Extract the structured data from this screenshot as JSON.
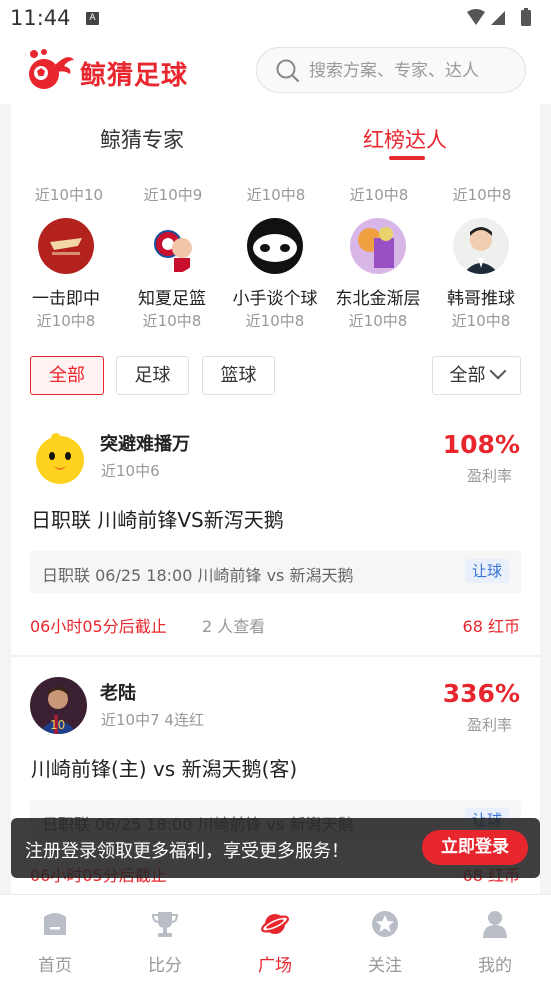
{
  "status_bar": {
    "time": "11:44",
    "notif_icon": "A"
  },
  "header": {
    "app_name": "鲸猜足球",
    "search_placeholder": "搜索方案、专家、达人"
  },
  "tabs": [
    "鲸猜专家",
    "红榜达人"
  ],
  "active_tab": 1,
  "experts_row1_records": [
    "近10中10",
    "近10中9",
    "近10中8",
    "近10中8",
    "近10中8"
  ],
  "experts_row2": [
    {
      "name": "一击即中",
      "record": "近10中8"
    },
    {
      "name": "知夏足篮",
      "record": "近10中8"
    },
    {
      "name": "小手谈个球",
      "record": "近10中8"
    },
    {
      "name": "东北金渐层",
      "record": "近10中8"
    },
    {
      "name": "韩哥推球",
      "record": "近10中8"
    }
  ],
  "filters": {
    "all": "全部",
    "football": "足球",
    "basketball": "篮球",
    "dropdown": "全部"
  },
  "posts": [
    {
      "author": "突避难播万",
      "record": "近10中6",
      "rate": "108%",
      "rate_label": "盈利率",
      "title": "日职联  川崎前锋VS新泻天鹅",
      "match": "日职联 06/25 18:00 川崎前锋 vs 新潟天鹅",
      "tag": "让球",
      "deadline": "06小时05分后截止",
      "views": "2 人查看",
      "price": "68 红币"
    },
    {
      "author": "老陆",
      "record": "近10中7   4连红",
      "rate": "336%",
      "rate_label": "盈利率",
      "title": "川崎前锋(主) vs 新潟天鹅(客)",
      "match": "日职联 06/25 18:00 川崎前锋 vs 新潟天鹅",
      "tag": "让球",
      "deadline": "06小时05分后截止",
      "views": "",
      "price": "68 红币"
    }
  ],
  "banner": {
    "text": "注册登录领取更多福利，享受更多服务！",
    "button": "立即登录"
  },
  "bottom_nav": [
    {
      "label": "首页",
      "icon": "home-icon"
    },
    {
      "label": "比分",
      "icon": "trophy-icon"
    },
    {
      "label": "广场",
      "icon": "planet-icon"
    },
    {
      "label": "关注",
      "icon": "star-icon"
    },
    {
      "label": "我的",
      "icon": "user-icon"
    }
  ],
  "colors": {
    "brand": "#e8262d",
    "tag_blue": "#3a74d8"
  }
}
